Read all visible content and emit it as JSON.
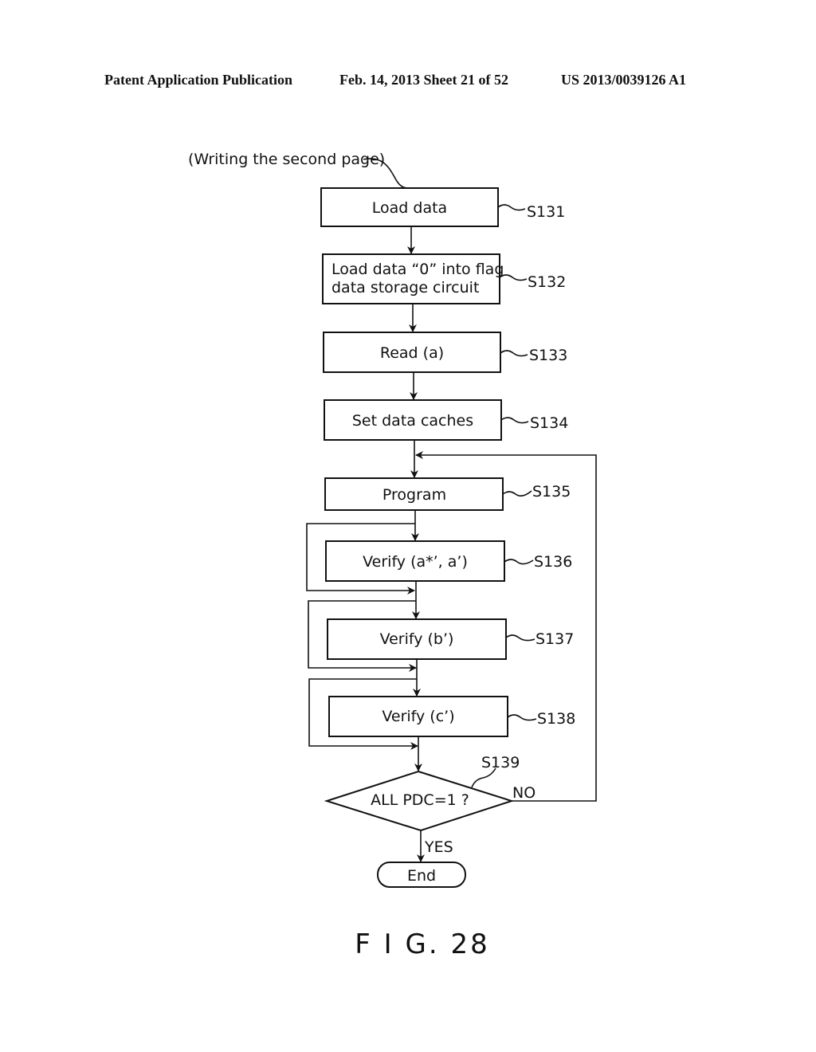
{
  "header": {
    "publication": "Patent Application Publication",
    "date_sheet": "Feb. 14, 2013   Sheet 21 of 52",
    "patent_number": "US 2013/0039126 A1"
  },
  "diagram": {
    "caption": "(Writing the second page)",
    "steps": [
      {
        "id": "S131",
        "text": [
          "Load data"
        ]
      },
      {
        "id": "S132",
        "text": [
          "Load data “0” into flag",
          "data storage circuit"
        ]
      },
      {
        "id": "S133",
        "text": [
          "Read (a)"
        ]
      },
      {
        "id": "S134",
        "text": [
          "Set data caches"
        ]
      },
      {
        "id": "S135",
        "text": [
          "Program"
        ]
      },
      {
        "id": "S136",
        "text": [
          "Verify (a*’, a’)"
        ]
      },
      {
        "id": "S137",
        "text": [
          "Verify (b’)"
        ]
      },
      {
        "id": "S138",
        "text": [
          "Verify (c’)"
        ]
      }
    ],
    "decision": {
      "id": "S139",
      "text": "ALL PDC=1 ?",
      "yes_label": "YES",
      "no_label": "NO"
    },
    "end_label": "End",
    "figure_label": "F I G. 28"
  }
}
